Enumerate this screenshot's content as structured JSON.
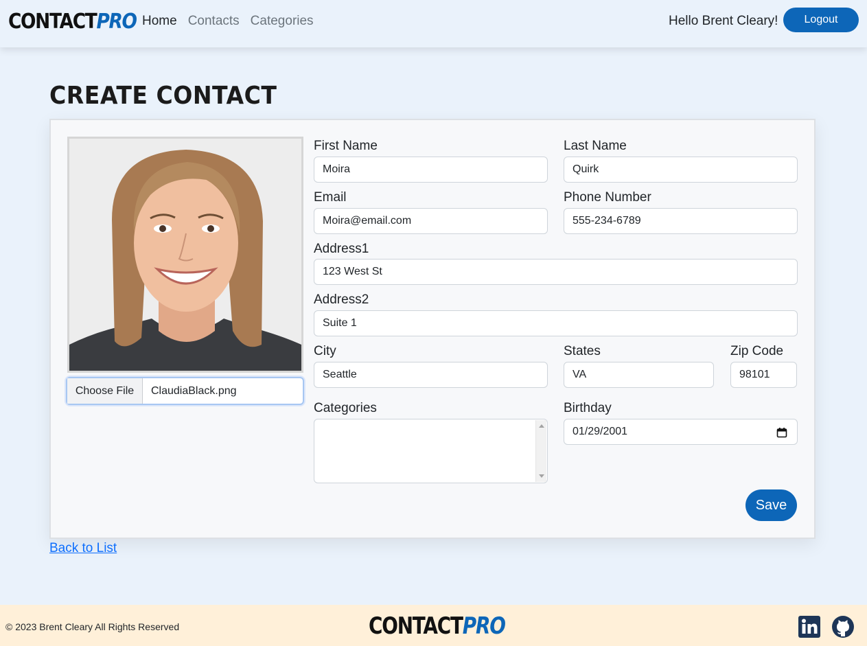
{
  "navbar": {
    "logo_part1": "CONTACT",
    "logo_part2": "PRO",
    "links": [
      "Home",
      "Contacts",
      "Categories"
    ],
    "greeting": "Hello Brent Cleary!",
    "logout_label": "Logout"
  },
  "page": {
    "title": "CREATE CONTACT",
    "back_link": "Back to List"
  },
  "form": {
    "file_button": "Choose File",
    "file_name": "ClaudiaBlack.png",
    "first_name_label": "First Name",
    "first_name_value": "Moira",
    "last_name_label": "Last Name",
    "last_name_value": "Quirk",
    "email_label": "Email",
    "email_value": "Moira@email.com",
    "phone_label": "Phone Number",
    "phone_value": "555-234-6789",
    "address1_label": "Address1",
    "address1_value": "123 West St",
    "address2_label": "Address2",
    "address2_value": "Suite 1",
    "city_label": "City",
    "city_value": "Seattle",
    "state_label": "States",
    "state_value": "VA",
    "zip_label": "Zip Code",
    "zip_value": "98101",
    "categories_label": "Categories",
    "birthday_label": "Birthday",
    "birthday_value": "01/29/2001",
    "save_label": "Save"
  },
  "footer": {
    "copyright": "© 2023 Brent Cleary All Rights Reserved",
    "logo_part1": "CONTACT",
    "logo_part2": "PRO",
    "icons": [
      "linkedin-icon",
      "github-icon"
    ]
  },
  "colors": {
    "brand_blue": "#0d66b8",
    "page_bg": "#eaf2fb",
    "footer_bg": "#fff0d9"
  }
}
